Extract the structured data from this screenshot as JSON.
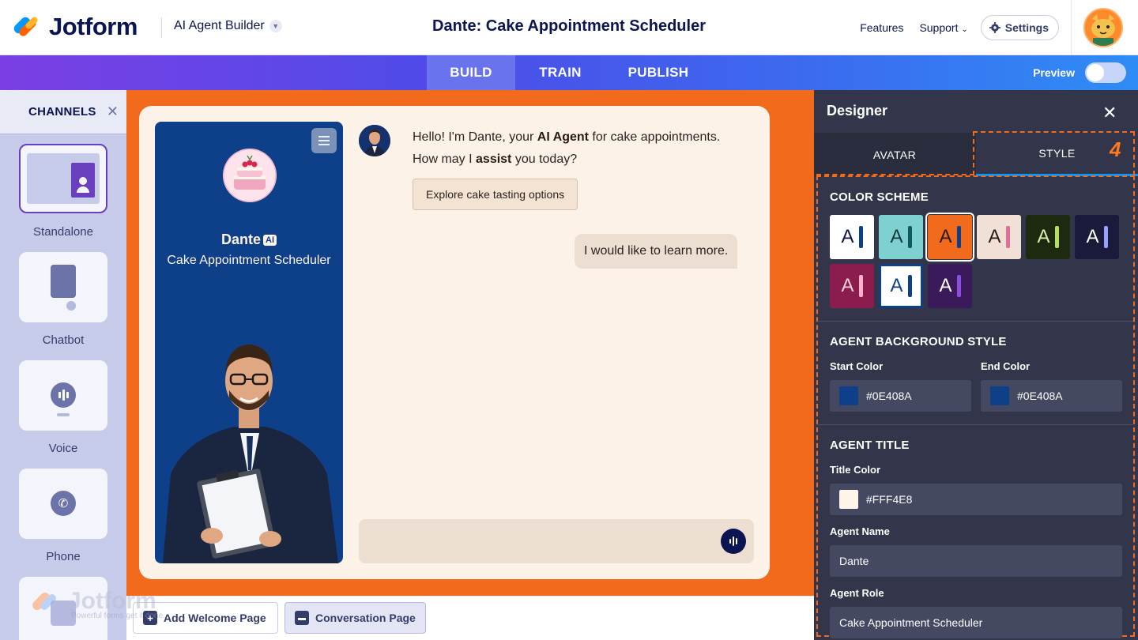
{
  "header": {
    "logo_text": "Jotform",
    "builder_label": "AI Agent Builder",
    "form_title": "Dante: Cake Appointment Scheduler",
    "nav_features": "Features",
    "nav_support": "Support",
    "settings_label": "Settings"
  },
  "tabs": {
    "build": "BUILD",
    "train": "TRAIN",
    "publish": "PUBLISH",
    "active": "BUILD",
    "preview_label": "Preview",
    "preview_on": false
  },
  "channels": {
    "title": "CHANNELS",
    "items": [
      {
        "label": "Standalone",
        "icon": "standalone-icon",
        "selected": true
      },
      {
        "label": "Chatbot",
        "icon": "chatbot-icon",
        "selected": false
      },
      {
        "label": "Voice",
        "icon": "voice-icon",
        "selected": false
      },
      {
        "label": "Phone",
        "icon": "phone-icon",
        "selected": false
      }
    ]
  },
  "chat": {
    "agent_name": "Dante",
    "ai_badge": "AI",
    "agent_role": "Cake Appointment Scheduler",
    "bot_msg_part1": "Hello! I'm Dante, your ",
    "bot_msg_bold1": "AI Agent",
    "bot_msg_part2": " for cake appointments. How may I ",
    "bot_msg_bold2": "assist",
    "bot_msg_part3": " you today?",
    "suggestion_chip": "Explore cake tasting options",
    "user_msg": "I would like to learn more."
  },
  "pages": {
    "welcome": "Add Welcome Page",
    "conversation": "Conversation Page",
    "watermark_text": "Jotform",
    "watermark_sub": "Powerful forms get it done."
  },
  "designer": {
    "title": "Designer",
    "tab_avatar": "AVATAR",
    "tab_style": "STYLE",
    "step_number": "4",
    "color_scheme_title": "COLOR SCHEME",
    "schemes": [
      {
        "bg": "#ffffff",
        "fg": "#0a1551",
        "bar": "#0e408a"
      },
      {
        "bg": "#7fd0d0",
        "fg": "#0b3b3b",
        "bar": "#0f5a5a"
      },
      {
        "bg": "#f26a1b",
        "fg": "#2b1a14",
        "bar": "#0e408a",
        "selected": true
      },
      {
        "bg": "#f0e0d6",
        "fg": "#2a1b1b",
        "bar": "#e56b9a"
      },
      {
        "bg": "#1e2a10",
        "fg": "#d9f0a6",
        "bar": "#b6e05a"
      },
      {
        "bg": "#1a1a3a",
        "fg": "#ffffff",
        "bar": "#9aa0ff"
      },
      {
        "bg": "#8a1d4d",
        "fg": "#ffd0e0",
        "bar": "#ffb0cc"
      },
      {
        "bg": "#0e408a",
        "fg": "#0e408a",
        "bar": "#0e408a"
      },
      {
        "bg": "#3a1a5a",
        "fg": "#ffffff",
        "bar": "#8a4fe0"
      }
    ],
    "bg_style_title": "AGENT BACKGROUND STYLE",
    "start_color_label": "Start Color",
    "start_color": "#0E408A",
    "end_color_label": "End Color",
    "end_color": "#0E408A",
    "agent_title_title": "AGENT TITLE",
    "title_color_label": "Title Color",
    "title_color": "#FFF4E8",
    "agent_name_label": "Agent Name",
    "agent_name_value": "Dante",
    "agent_role_label": "Agent Role",
    "agent_role_value": "Cake Appointment Scheduler"
  }
}
